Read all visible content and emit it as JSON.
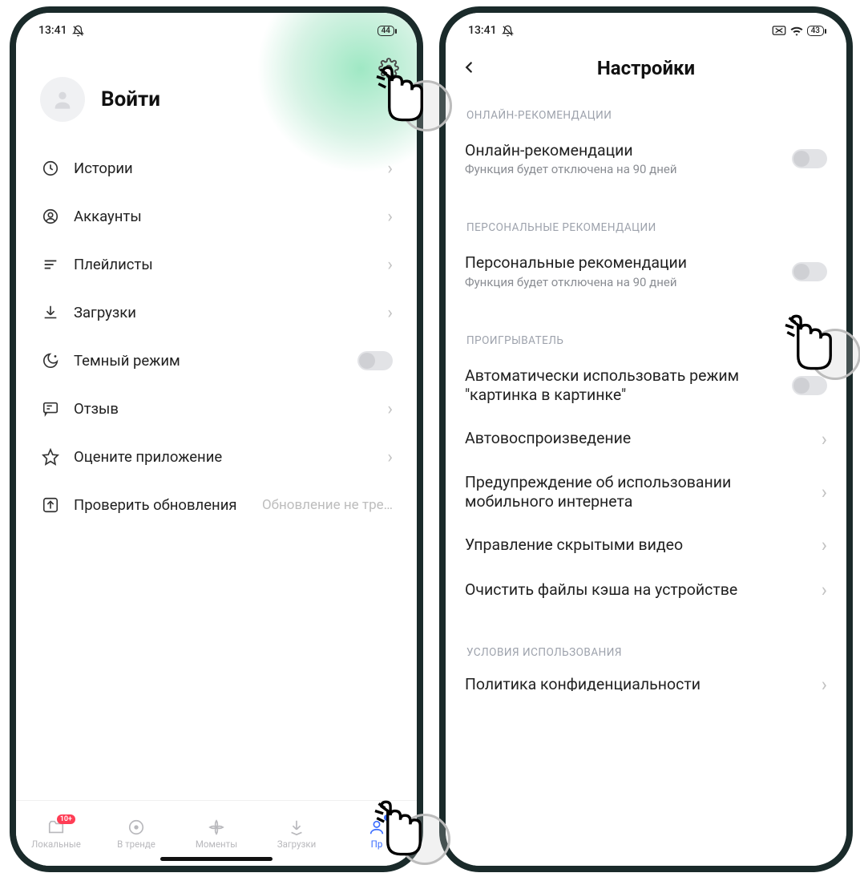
{
  "status": {
    "time": "13:41",
    "battery": "44",
    "battery2": "43"
  },
  "left": {
    "login": "Войти",
    "menu": [
      {
        "icon": "clock",
        "label": "Истории",
        "type": "chev"
      },
      {
        "icon": "user",
        "label": "Аккаунты",
        "type": "chev"
      },
      {
        "icon": "list",
        "label": "Плейлисты",
        "type": "chev"
      },
      {
        "icon": "download",
        "label": "Загрузки",
        "type": "chev"
      },
      {
        "icon": "moon",
        "label": "Темный режим",
        "type": "switch"
      },
      {
        "icon": "chat",
        "label": "Отзыв",
        "type": "chev"
      },
      {
        "icon": "star",
        "label": "Оцените приложение",
        "type": "chev"
      },
      {
        "icon": "update",
        "label": "Проверить обновления",
        "sub": "Обновление не тре…",
        "type": "none"
      }
    ],
    "nav": [
      {
        "label": "Локальные",
        "icon": "folder",
        "badge": "10+"
      },
      {
        "label": "В тренде",
        "icon": "trend"
      },
      {
        "label": "Моменты",
        "icon": "moments"
      },
      {
        "label": "Загрузки",
        "icon": "dl"
      },
      {
        "label": "Пр",
        "icon": "profile",
        "active": true,
        "dot": true
      }
    ]
  },
  "right": {
    "title": "Настройки",
    "sections": [
      {
        "header": "ОНЛАЙН-РЕКОМЕНДАЦИИ",
        "rows": [
          {
            "title": "Онлайн-рекомендации",
            "sub": "Функция будет отключена на 90 дней",
            "type": "switch"
          }
        ]
      },
      {
        "header": "ПЕРСОНАЛЬНЫЕ РЕКОМЕНДАЦИИ",
        "rows": [
          {
            "title": "Персональные рекомендации",
            "sub": "Функция будет отключена на 90 дней",
            "type": "switch"
          }
        ]
      },
      {
        "header": "ПРОИГРЫВАТЕЛЬ",
        "rows": [
          {
            "title": "Автоматически использовать режим \"картинка в картинке\"",
            "type": "switch"
          },
          {
            "title": "Автовоспроизведение",
            "type": "chev"
          },
          {
            "title": "Предупреждение об использовании мобильного интернета",
            "type": "chev"
          },
          {
            "title": "Управление скрытыми видео",
            "type": "chev"
          },
          {
            "title": "Очистить файлы кэша на устройстве",
            "type": "chev"
          }
        ]
      },
      {
        "header": "УСЛОВИЯ ИСПОЛЬЗОВАНИЯ",
        "rows": [
          {
            "title": "Политика конфиденциальности",
            "type": "chev",
            "cut": true
          }
        ]
      }
    ]
  }
}
